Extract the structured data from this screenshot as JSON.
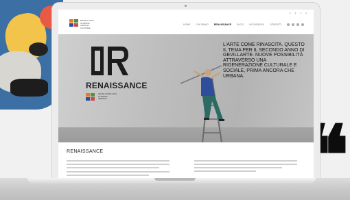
{
  "header": {
    "logo_text": [
      "BONELLARTE",
      "GUARDIA",
      "URBANA",
      "CUSTODE"
    ],
    "nav": [
      {
        "label": "HOME",
        "active": false
      },
      {
        "label": "CHI SIAMO",
        "active": false
      },
      {
        "label": "RENAISSANCE",
        "active": true
      },
      {
        "label": "BLOG",
        "active": false
      },
      {
        "label": "IN EVIDENZA",
        "active": false
      },
      {
        "label": "CONTATTI",
        "active": false
      }
    ],
    "social_icons": [
      "facebook-icon",
      "twitter-icon",
      "instagram-icon",
      "search-icon"
    ]
  },
  "hero": {
    "logo_word": "RENAISSANCE",
    "sub_logo_text": [
      "GEVELLARTE 2021",
      "GUARDIA",
      "URBANA"
    ],
    "headline": "L'ARTE COME RINASCITA. QUESTO IL TEMA PER IL SECONDO ANNO DI GEVILLARTE. NUOVE POSSIBILITÀ ATTRAVERSO UNA RIGENERAZIONE CULTURALE E SOCIALE, PRIMA ANCORA CHE URBANA."
  },
  "article": {
    "title": "RENAISSANCE"
  },
  "colors": {
    "hero_bg": "#bdbdbd",
    "text_dark": "#151515",
    "shirt_blue": "#2f4d9a",
    "pants_green": "#2c6b63",
    "logo_orange": "#e57a2f",
    "logo_green": "#5a8f3c"
  }
}
